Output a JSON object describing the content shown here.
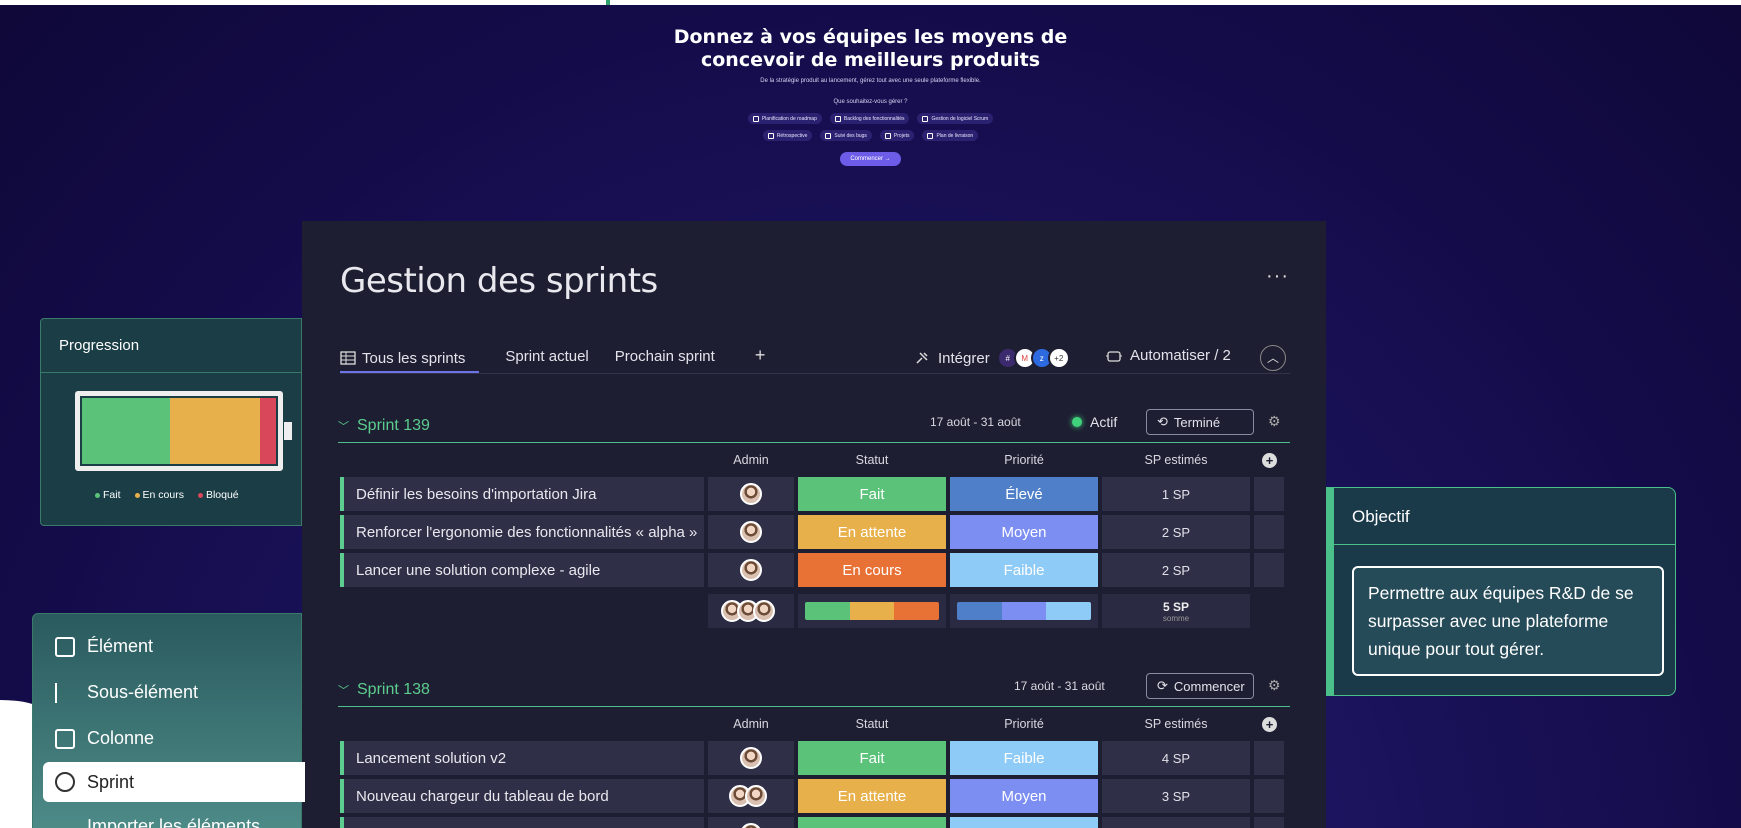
{
  "hero": {
    "title_line1": "Donnez à vos équipes les moyens de",
    "title_line2": "concevoir de meilleurs produits",
    "subtitle": "De la stratégie produit au lancement, gérez tout avec une seule plateforme flexible.",
    "question": "Que souhaitez-vous gérer ?",
    "options_row1": [
      "Planification de roadmap",
      "Backlog des fonctionnalités",
      "Gestion de logiciel Scrum"
    ],
    "options_row2": [
      "Rétrospective",
      "Suivi des bugs",
      "Projets",
      "Plan de livraison"
    ],
    "cta": "Commencer →"
  },
  "board": {
    "title": "Gestion des sprints",
    "more": "···",
    "tabs": [
      "Tous les sprints",
      "Sprint actuel",
      "Prochain sprint"
    ],
    "tab_add": "+",
    "integrate_label": "Intégrer",
    "integrate_more": "+2",
    "automate_label": "Automatiser / 2",
    "columns": [
      "Admin",
      "Statut",
      "Priorité",
      "SP estimés"
    ],
    "colors": {
      "fait": "#5bc27a",
      "attente": "#e8b04a",
      "cours": "#e87236",
      "eleve": "#4f7fc8",
      "moyen": "#7d8ef2",
      "faible": "#8fcbf7",
      "accent": "#5ccd8e"
    }
  },
  "sprint139": {
    "name": "Sprint 139",
    "dates": "17 août - 31 août",
    "active": "Actif",
    "button": "Terminé",
    "rows": [
      {
        "name": "Définir les besoins d'importation Jira",
        "status": "Fait",
        "priority": "Élevé",
        "sp": "1 SP"
      },
      {
        "name": "Renforcer l'ergonomie des fonctionnalités « alpha »",
        "status": "En attente",
        "priority": "Moyen",
        "sp": "2 SP"
      },
      {
        "name": "Lancer une solution complexe - agile",
        "status": "En cours",
        "priority": "Faible",
        "sp": "2 SP"
      }
    ],
    "total": "5 SP",
    "total_label": "somme"
  },
  "sprint138": {
    "name": "Sprint 138",
    "dates": "17 août - 31 août",
    "button": "Commencer",
    "rows": [
      {
        "name": "Lancement solution v2",
        "status": "Fait",
        "priority": "Faible",
        "sp": "4 SP"
      },
      {
        "name": "Nouveau chargeur du tableau de bord",
        "status": "En attente",
        "priority": "Moyen",
        "sp": "3 SP"
      }
    ]
  },
  "progress": {
    "title": "Progression",
    "legend": [
      "Fait",
      "En cours",
      "Bloqué"
    ]
  },
  "menu": {
    "items": [
      "Élément",
      "Sous-élément",
      "Colonne",
      "Sprint",
      "Importer les éléments"
    ]
  },
  "objective": {
    "title": "Objectif",
    "text": "Permettre aux équipes R&D de se surpasser avec une plateforme unique pour tout gérer."
  }
}
